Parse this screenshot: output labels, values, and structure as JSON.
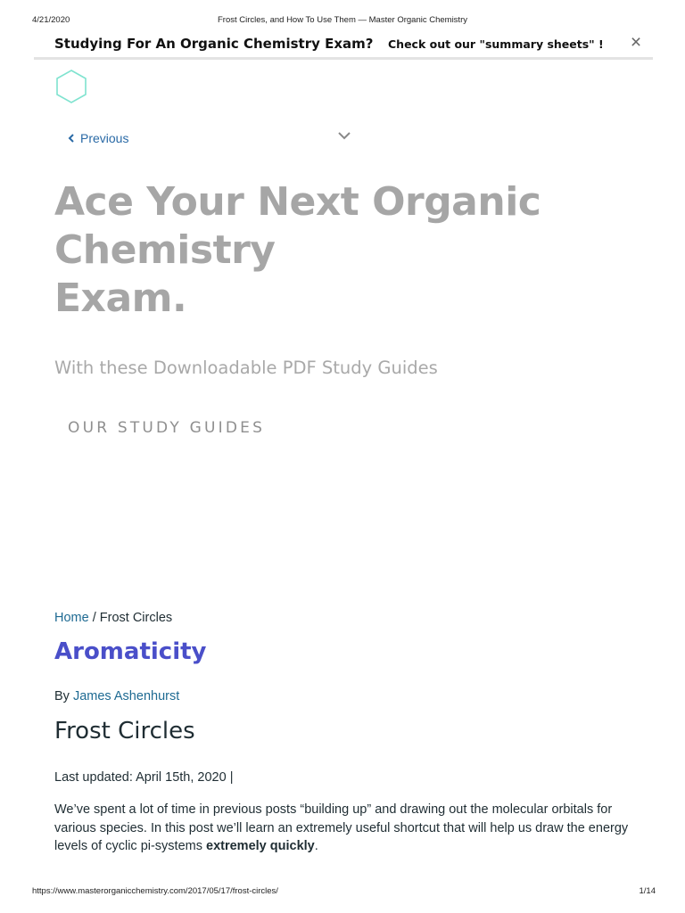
{
  "print_header": {
    "date": "4/21/2020",
    "title": "Frost Circles, and How To Use Them — Master Organic Chemistry"
  },
  "promo": {
    "left_text": "Studying For An Organic Chemistry Exam?",
    "right_text": "Check out our  \"summary sheets\" !",
    "close_icon": "×"
  },
  "colors": {
    "logo": "#7fe3cf",
    "link": "#1e6a92",
    "category": "#4a4fc9",
    "hero": "#a6a6a6"
  },
  "icons": {
    "logo": "hexagon-logo-icon",
    "previous": "chevron-left-icon",
    "dropdown": "chevron-down-icon",
    "close": "close-icon"
  },
  "nav": {
    "previous_label": "Previous"
  },
  "hero": {
    "title_lines": [
      "Ace Your Next Organic",
      "Chemistry",
      "Exam."
    ],
    "subtitle": "With these Downloadable PDF Study Guides",
    "cta": "OUR STUDY GUIDES"
  },
  "breadcrumb": {
    "home": "Home",
    "separator": " / ",
    "current": "Frost Circles"
  },
  "article": {
    "category": "Aromaticity",
    "by_label": "By ",
    "author": "James Ashenhurst",
    "title": "Frost Circles",
    "updated": "Last updated: April 15th, 2020 |",
    "intro_text": "We’ve spent a lot of time in previous posts “building up” and drawing out the molecular orbitals for various species. In this post we’ll learn an extremely useful shortcut that will help us draw the energy levels of cyclic pi-systems ",
    "intro_bold": "extremely quickly",
    "intro_end": "."
  },
  "print_footer": {
    "url": "https://www.masterorganicchemistry.com/2017/05/17/frost-circles/",
    "page": "1/14"
  }
}
